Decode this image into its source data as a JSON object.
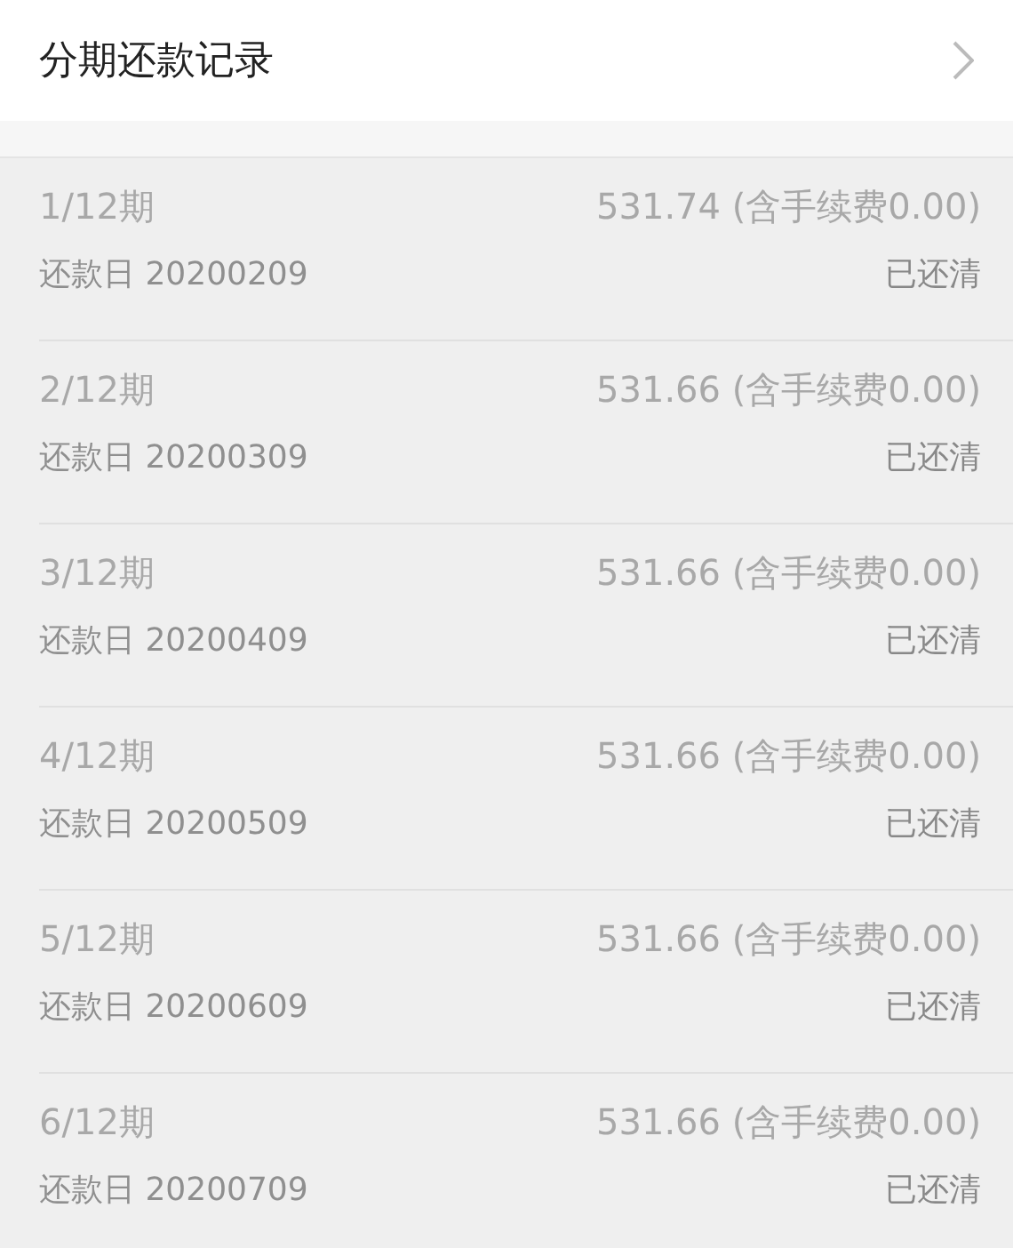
{
  "header": {
    "title": "分期还款记录"
  },
  "installments": [
    {
      "period": "1/12期",
      "amount": "531.74 (含手续费0.00)",
      "date": "还款日 20200209",
      "status": "已还清"
    },
    {
      "period": "2/12期",
      "amount": "531.66 (含手续费0.00)",
      "date": "还款日 20200309",
      "status": "已还清"
    },
    {
      "period": "3/12期",
      "amount": "531.66 (含手续费0.00)",
      "date": "还款日 20200409",
      "status": "已还清"
    },
    {
      "period": "4/12期",
      "amount": "531.66 (含手续费0.00)",
      "date": "还款日 20200509",
      "status": "已还清"
    },
    {
      "period": "5/12期",
      "amount": "531.66 (含手续费0.00)",
      "date": "还款日 20200609",
      "status": "已还清"
    },
    {
      "period": "6/12期",
      "amount": "531.66 (含手续费0.00)",
      "date": "还款日 20200709",
      "status": "已还清"
    }
  ]
}
